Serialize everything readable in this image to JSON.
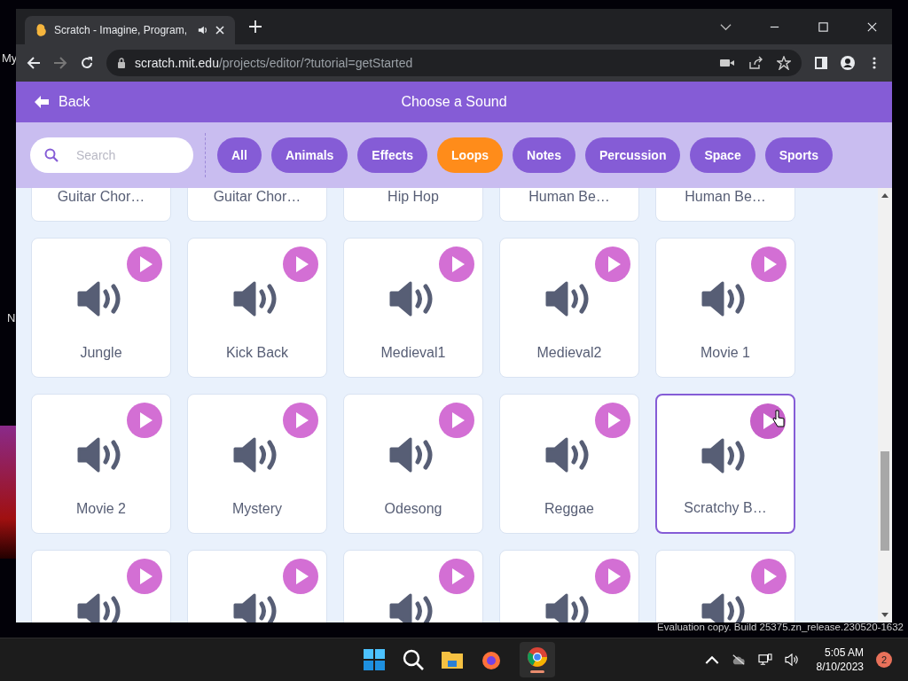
{
  "desktop": {
    "labels": [
      "My",
      "N"
    ],
    "notice": "Evaluation copy. Build 25375.zn_release.230520-1632"
  },
  "browser": {
    "tab_title": "Scratch - Imagine, Program,",
    "url_host": "scratch.mit.edu",
    "url_path": "/projects/editor/?tutorial=getStarted"
  },
  "header": {
    "back": "Back",
    "title": "Choose a Sound"
  },
  "search": {
    "placeholder": "Search"
  },
  "categories": [
    {
      "label": "All",
      "selected": false
    },
    {
      "label": "Animals",
      "selected": false
    },
    {
      "label": "Effects",
      "selected": false
    },
    {
      "label": "Loops",
      "selected": true
    },
    {
      "label": "Notes",
      "selected": false
    },
    {
      "label": "Percussion",
      "selected": false
    },
    {
      "label": "Space",
      "selected": false
    },
    {
      "label": "Sports",
      "selected": false
    }
  ],
  "sounds": [
    {
      "name": "Guitar Chor…",
      "selected": false
    },
    {
      "name": "Guitar Chor…",
      "selected": false
    },
    {
      "name": "Hip Hop",
      "selected": false
    },
    {
      "name": "Human Be…",
      "selected": false
    },
    {
      "name": "Human Be…",
      "selected": false
    },
    {
      "name": "Jungle",
      "selected": false
    },
    {
      "name": "Kick Back",
      "selected": false
    },
    {
      "name": "Medieval1",
      "selected": false
    },
    {
      "name": "Medieval2",
      "selected": false
    },
    {
      "name": "Movie 1",
      "selected": false
    },
    {
      "name": "Movie 2",
      "selected": false
    },
    {
      "name": "Mystery",
      "selected": false
    },
    {
      "name": "Odesong",
      "selected": false
    },
    {
      "name": "Reggae",
      "selected": false
    },
    {
      "name": "Scratchy B…",
      "selected": true
    },
    {
      "selected": false
    },
    {
      "selected": false
    },
    {
      "selected": false
    },
    {
      "selected": false
    },
    {
      "selected": false
    }
  ],
  "taskbar": {
    "time": "5:05 AM",
    "date": "8/10/2023",
    "notifications": "2"
  }
}
